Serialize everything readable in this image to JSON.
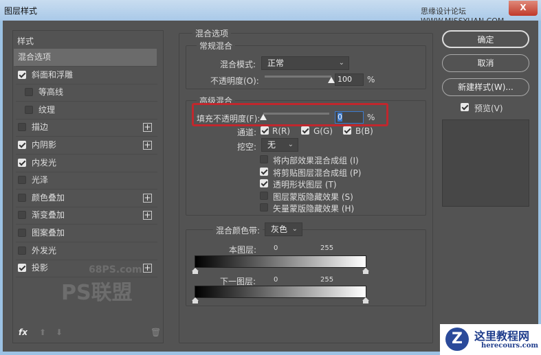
{
  "window": {
    "title": "图层样式",
    "site_watermark": "思缘设计论坛 WWW.MISSYUAN.COM",
    "close": "X"
  },
  "left": {
    "header": "样式",
    "items": [
      {
        "label": "混合选项",
        "checkbox": false,
        "checked": false,
        "plus": false,
        "selected": true
      },
      {
        "label": "斜面和浮雕",
        "checkbox": true,
        "checked": true,
        "plus": false
      },
      {
        "label": "等高线",
        "checkbox": true,
        "checked": false,
        "plus": false,
        "indent": true
      },
      {
        "label": "纹理",
        "checkbox": true,
        "checked": false,
        "plus": false,
        "indent": true
      },
      {
        "label": "描边",
        "checkbox": true,
        "checked": false,
        "plus": true
      },
      {
        "label": "内阴影",
        "checkbox": true,
        "checked": true,
        "plus": true
      },
      {
        "label": "内发光",
        "checkbox": true,
        "checked": true,
        "plus": false
      },
      {
        "label": "光泽",
        "checkbox": true,
        "checked": false,
        "plus": false
      },
      {
        "label": "颜色叠加",
        "checkbox": true,
        "checked": false,
        "plus": true
      },
      {
        "label": "渐变叠加",
        "checkbox": true,
        "checked": false,
        "plus": true
      },
      {
        "label": "图案叠加",
        "checkbox": true,
        "checked": false,
        "plus": false
      },
      {
        "label": "外发光",
        "checkbox": true,
        "checked": false,
        "plus": false
      },
      {
        "label": "投影",
        "checkbox": true,
        "checked": true,
        "plus": true
      }
    ],
    "fx": "fx",
    "watermark": "68PS.com PS联盟"
  },
  "blend": {
    "title": "混合选项",
    "general": {
      "title": "常规混合",
      "mode_label": "混合模式:",
      "mode_value": "正常",
      "opacity_label": "不透明度(O):",
      "opacity_value": "100",
      "opacity_unit": "%",
      "opacity": 100
    },
    "advanced": {
      "title": "高级混合",
      "fill_label": "填充不透明度(F):",
      "fill_value": "0",
      "fill_unit": "%",
      "fill": 0,
      "channels_label": "通道:",
      "r": "R(R)",
      "g": "G(G)",
      "b": "B(B)",
      "knockout_label": "挖空:",
      "knockout_value": "无",
      "options": [
        {
          "label": "将内部效果混合成组 (I)",
          "checked": false
        },
        {
          "label": "将剪贴图层混合成组 (P)",
          "checked": true
        },
        {
          "label": "透明形状图层 (T)",
          "checked": true
        },
        {
          "label": "图层蒙版隐藏效果 (S)",
          "checked": false
        },
        {
          "label": "矢量蒙版隐藏效果 (H)",
          "checked": false
        }
      ]
    },
    "blendif": {
      "label": "混合颜色带:",
      "value": "灰色",
      "this_layer": "本图层:",
      "under_layer": "下一图层:",
      "min": "0",
      "max": "255"
    }
  },
  "buttons": {
    "ok": "确定",
    "cancel": "取消",
    "new_style": "新建样式(W)...",
    "preview": "预览(V)"
  },
  "badge": {
    "name": "这里教程网",
    "url": "herecours.com"
  },
  "colors": {
    "highlight": "#c1272d"
  }
}
